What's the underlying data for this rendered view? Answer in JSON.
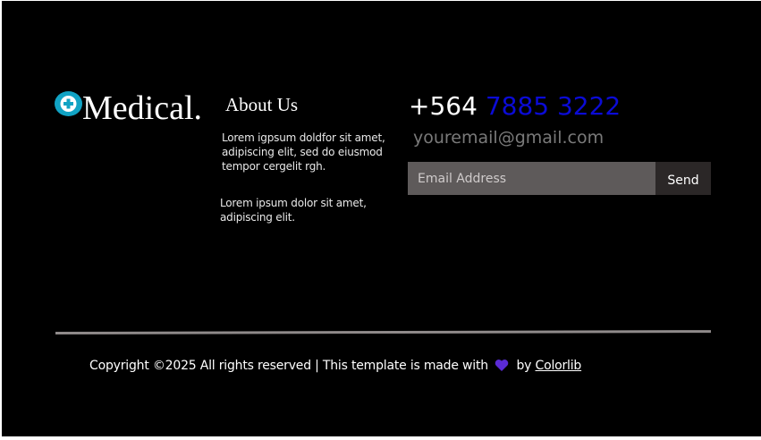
{
  "logo": {
    "text": "Medical.",
    "icon": "medical-cross-icon",
    "icon_color": "#11a3c4"
  },
  "about": {
    "title": "About Us",
    "paragraph_1": "Lorem igpsum doldfor sit amet, adipiscing elit, sed do eiusmod tempor cergelit rgh.",
    "paragraph_2": "Lorem ipsum dolor sit amet, adipiscing elit."
  },
  "contact": {
    "phone_prefix": "+564",
    "phone_number": "7885 3222",
    "phone_number_color": "#0b0bd6",
    "email": "youremail@gmail.com"
  },
  "subscribe": {
    "placeholder": "Email Address",
    "value": "",
    "button_label": "Send"
  },
  "footer": {
    "copyright": "Copyright ©2025 All rights reserved | This template is made with",
    "heart_icon": "heart-icon",
    "heart_color": "#5b2bd6",
    "by": "by",
    "credit_link": "Colorlib"
  }
}
